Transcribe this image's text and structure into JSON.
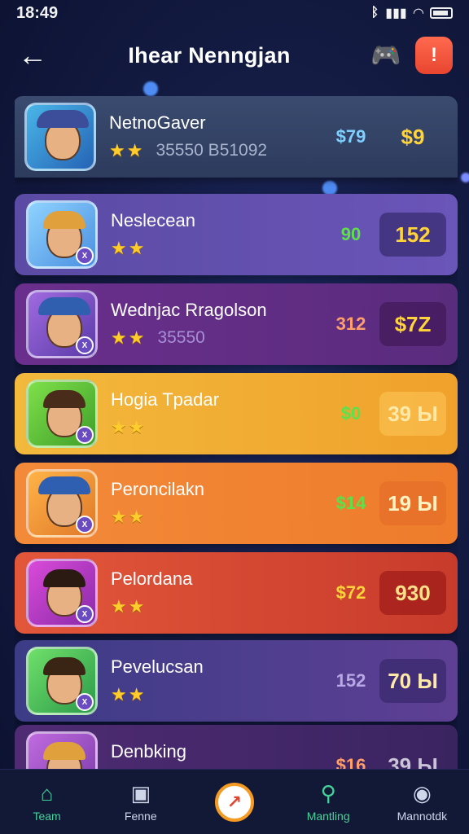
{
  "status": {
    "time": "18:49"
  },
  "header": {
    "title": "Ihear Nenngjan"
  },
  "rows": [
    {
      "name": "NetnoGaver",
      "stars": "★★",
      "meta": "35550 B51092",
      "price": "$79",
      "score": "$9",
      "price_color": "#7fd0ff",
      "score_color": "#ffd43b"
    },
    {
      "name": "Neslecean",
      "stars": "★★",
      "meta": "",
      "price": "90",
      "score": "152",
      "price_color": "#5ee04a",
      "score_color": "#ffd43b"
    },
    {
      "name": "Wednjac Rragolson",
      "stars": "★★",
      "meta": "35550",
      "price": "312",
      "score": "$7Z",
      "price_color": "#ff9f6b",
      "score_color": "#ffd43b"
    },
    {
      "name": "Hogia Tpadar",
      "stars": "★★",
      "meta": "",
      "price": "$0",
      "score": "39 Ы",
      "price_color": "#5ee04a",
      "score_color": "#ffe9a8"
    },
    {
      "name": "Peroncilakn",
      "stars": "★★",
      "meta": "",
      "price": "$14",
      "score": "19 Ы",
      "price_color": "#5ee04a",
      "score_color": "#fff3c4"
    },
    {
      "name": "Pelordana",
      "stars": "★★",
      "meta": "",
      "price": "$72",
      "score": "930",
      "price_color": "#ffd43b",
      "score_color": "#ffe08a"
    },
    {
      "name": "Pevelucsan",
      "stars": "★★",
      "meta": "",
      "price": "152",
      "score": "70 Ы",
      "price_color": "#b7a8e6",
      "score_color": "#ffe9a8"
    },
    {
      "name": "Denbking",
      "stars": "★★",
      "meta": "",
      "price": "$16",
      "score": "39 Ы",
      "price_color": "#ff9f6b",
      "score_color": "#c9c4d8"
    }
  ],
  "nav": [
    {
      "label": "Team",
      "icon": "home-icon"
    },
    {
      "label": "Fenne",
      "icon": "image-icon"
    },
    {
      "label": "",
      "icon": "compass-icon"
    },
    {
      "label": "Mantling",
      "icon": "search-icon"
    },
    {
      "label": "Mannotdk",
      "icon": "profile-icon"
    }
  ]
}
